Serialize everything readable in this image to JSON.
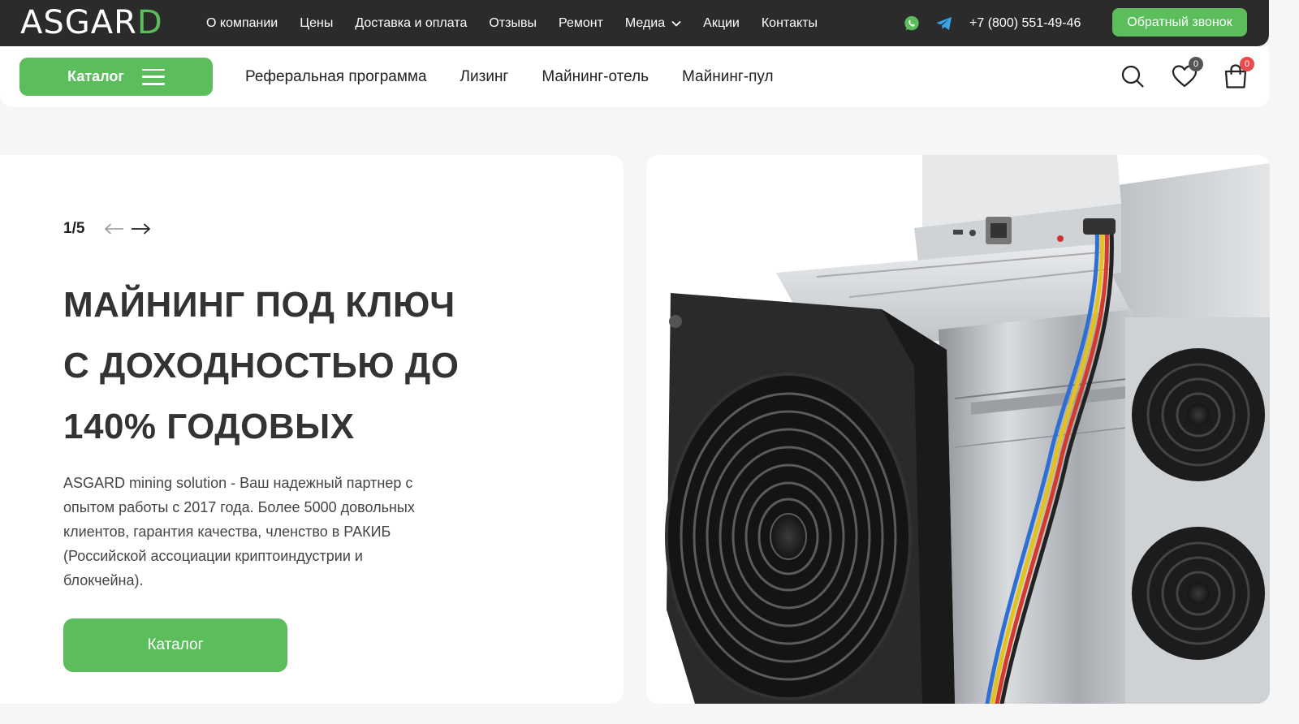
{
  "brand": {
    "logo_main": "ASGAR",
    "logo_accent": "D"
  },
  "topnav": {
    "items": [
      {
        "label": "О компании"
      },
      {
        "label": "Цены"
      },
      {
        "label": "Доставка и оплата"
      },
      {
        "label": "Отзывы"
      },
      {
        "label": "Ремонт"
      },
      {
        "label": "Медиа"
      },
      {
        "label": "Акции"
      },
      {
        "label": "Контакты"
      }
    ],
    "phone": "+7 (800) 551-49-46",
    "callback_label": "Обратный звонок"
  },
  "navbar": {
    "catalog_label": "Каталог",
    "items": [
      {
        "label": "Реферальная программа"
      },
      {
        "label": "Лизинг"
      },
      {
        "label": "Майнинг-отель"
      },
      {
        "label": "Майнинг-пул"
      }
    ],
    "favorites_count": "0",
    "cart_count": "0"
  },
  "hero": {
    "counter": "1/5",
    "title_line1": "МАЙНИНГ ПОД КЛЮЧ",
    "title_line2": "С ДОХОДНОСТЬЮ ДО",
    "title_line3": "140% ГОДОВЫХ",
    "description": "ASGARD mining solution - Ваш надежный партнер с опытом работы с 2017 года. Более 5000 довольных клиентов, гарантия качества, членство в РАКИБ (Российской ассоциации криптоиндустрии и блокчейна).",
    "cta_label": "Каталог"
  },
  "colors": {
    "accent": "#5bbd5c",
    "topbar": "#2b2b2b",
    "badge_red": "#e84c4c",
    "page_bg": "#f6f6f6"
  },
  "icons": [
    "whatsapp-icon",
    "telegram-icon",
    "chevron-down-icon",
    "menu-icon",
    "search-icon",
    "heart-icon",
    "cart-icon",
    "arrow-left-icon",
    "arrow-right-icon"
  ]
}
